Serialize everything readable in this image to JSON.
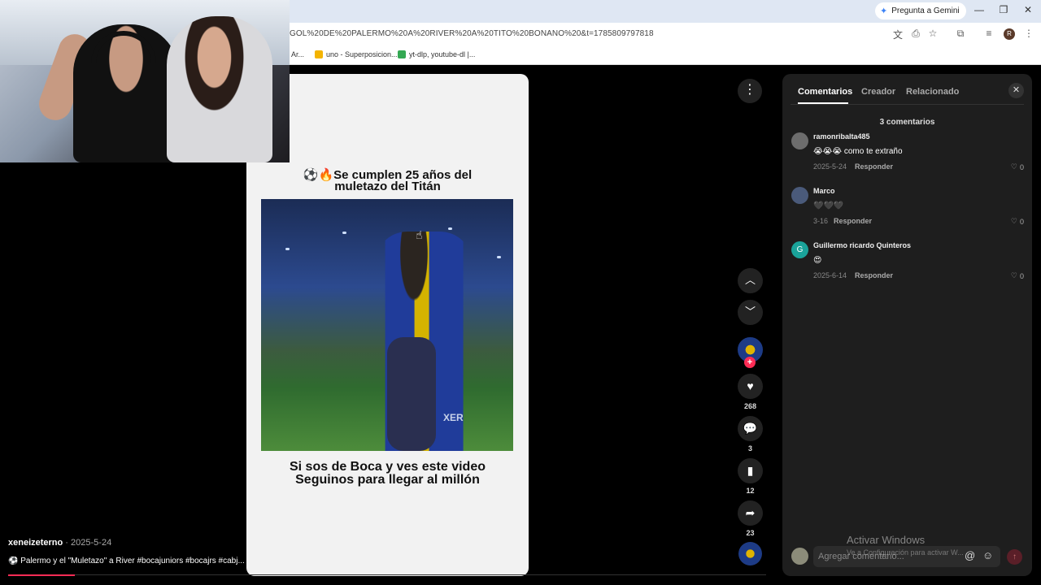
{
  "browser": {
    "gemini_label": "Pregunta a Gemini",
    "url": "GOL%20DE%20PALERMO%20A%20RIVER%20A%20TITO%20BONANO%20&t=1785809797818",
    "profile_initial": "R",
    "bookmarks": [
      {
        "label": "Ar...",
        "color": "#4285f4"
      },
      {
        "label": "uno - Superposicion...",
        "color": "#f4b400"
      },
      {
        "label": "yt-dlp, youtube-dl |...",
        "color": "#34a853"
      }
    ]
  },
  "video": {
    "title_line1": "⚽🔥Se cumplen 25 años del",
    "title_line2": "muletazo del Titán",
    "jersey_text": "XER",
    "bottom_line1": "Si sos de Boca y ves este video",
    "bottom_line2": "Seguinos para llegar al millón"
  },
  "post": {
    "author": "xeneizeterno",
    "date_sep": " · ",
    "date": "2025-5-24",
    "caption": "⚽ Palermo y el \"Muletazo\" a River #bocajuniors #bocajrs #cabj..."
  },
  "actions": {
    "likes": "268",
    "comments": "3",
    "saves": "12",
    "shares": "23"
  },
  "panel": {
    "tabs": [
      "Comentarios",
      "Creador",
      "Relacionado"
    ],
    "count_label": "3 comentarios",
    "reply_label": "Responder",
    "input_placeholder": "Agregar comentario...",
    "comments": [
      {
        "user": "ramonribalta485",
        "text": "😭😭😭 como te extraño",
        "date": "2025-5-24",
        "likes": "0",
        "avatar_color": "#6d6d6d",
        "avatar_letter": ""
      },
      {
        "user": "Marco",
        "text": "🖤🖤🖤",
        "date": "3-16",
        "likes": "0",
        "avatar_color": "#4a5a7a",
        "avatar_letter": ""
      },
      {
        "user": "Guillermo ricardo Quinteros",
        "text": "😍",
        "date": "2025-6-14",
        "likes": "0",
        "avatar_color": "#1aa39a",
        "avatar_letter": "G"
      }
    ]
  },
  "watermark": {
    "line1": "Activar Windows",
    "line2": "Ve a Configuración para activar W..."
  },
  "progress": 0.088
}
